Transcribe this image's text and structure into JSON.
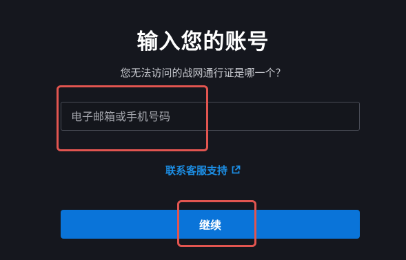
{
  "header": {
    "title": "输入您的账号",
    "subtitle": "您无法访问的战网通行证是哪一个？"
  },
  "form": {
    "account_placeholder": "电子邮箱或手机号码",
    "account_value": ""
  },
  "support": {
    "label": "联系客服支持",
    "icon": "external-link-icon"
  },
  "actions": {
    "continue_label": "继续"
  },
  "annotations": {
    "highlight_color": "#e25550"
  },
  "colors": {
    "background": "#15171e",
    "accent": "#0a74d9",
    "link": "#1c8fe6"
  }
}
